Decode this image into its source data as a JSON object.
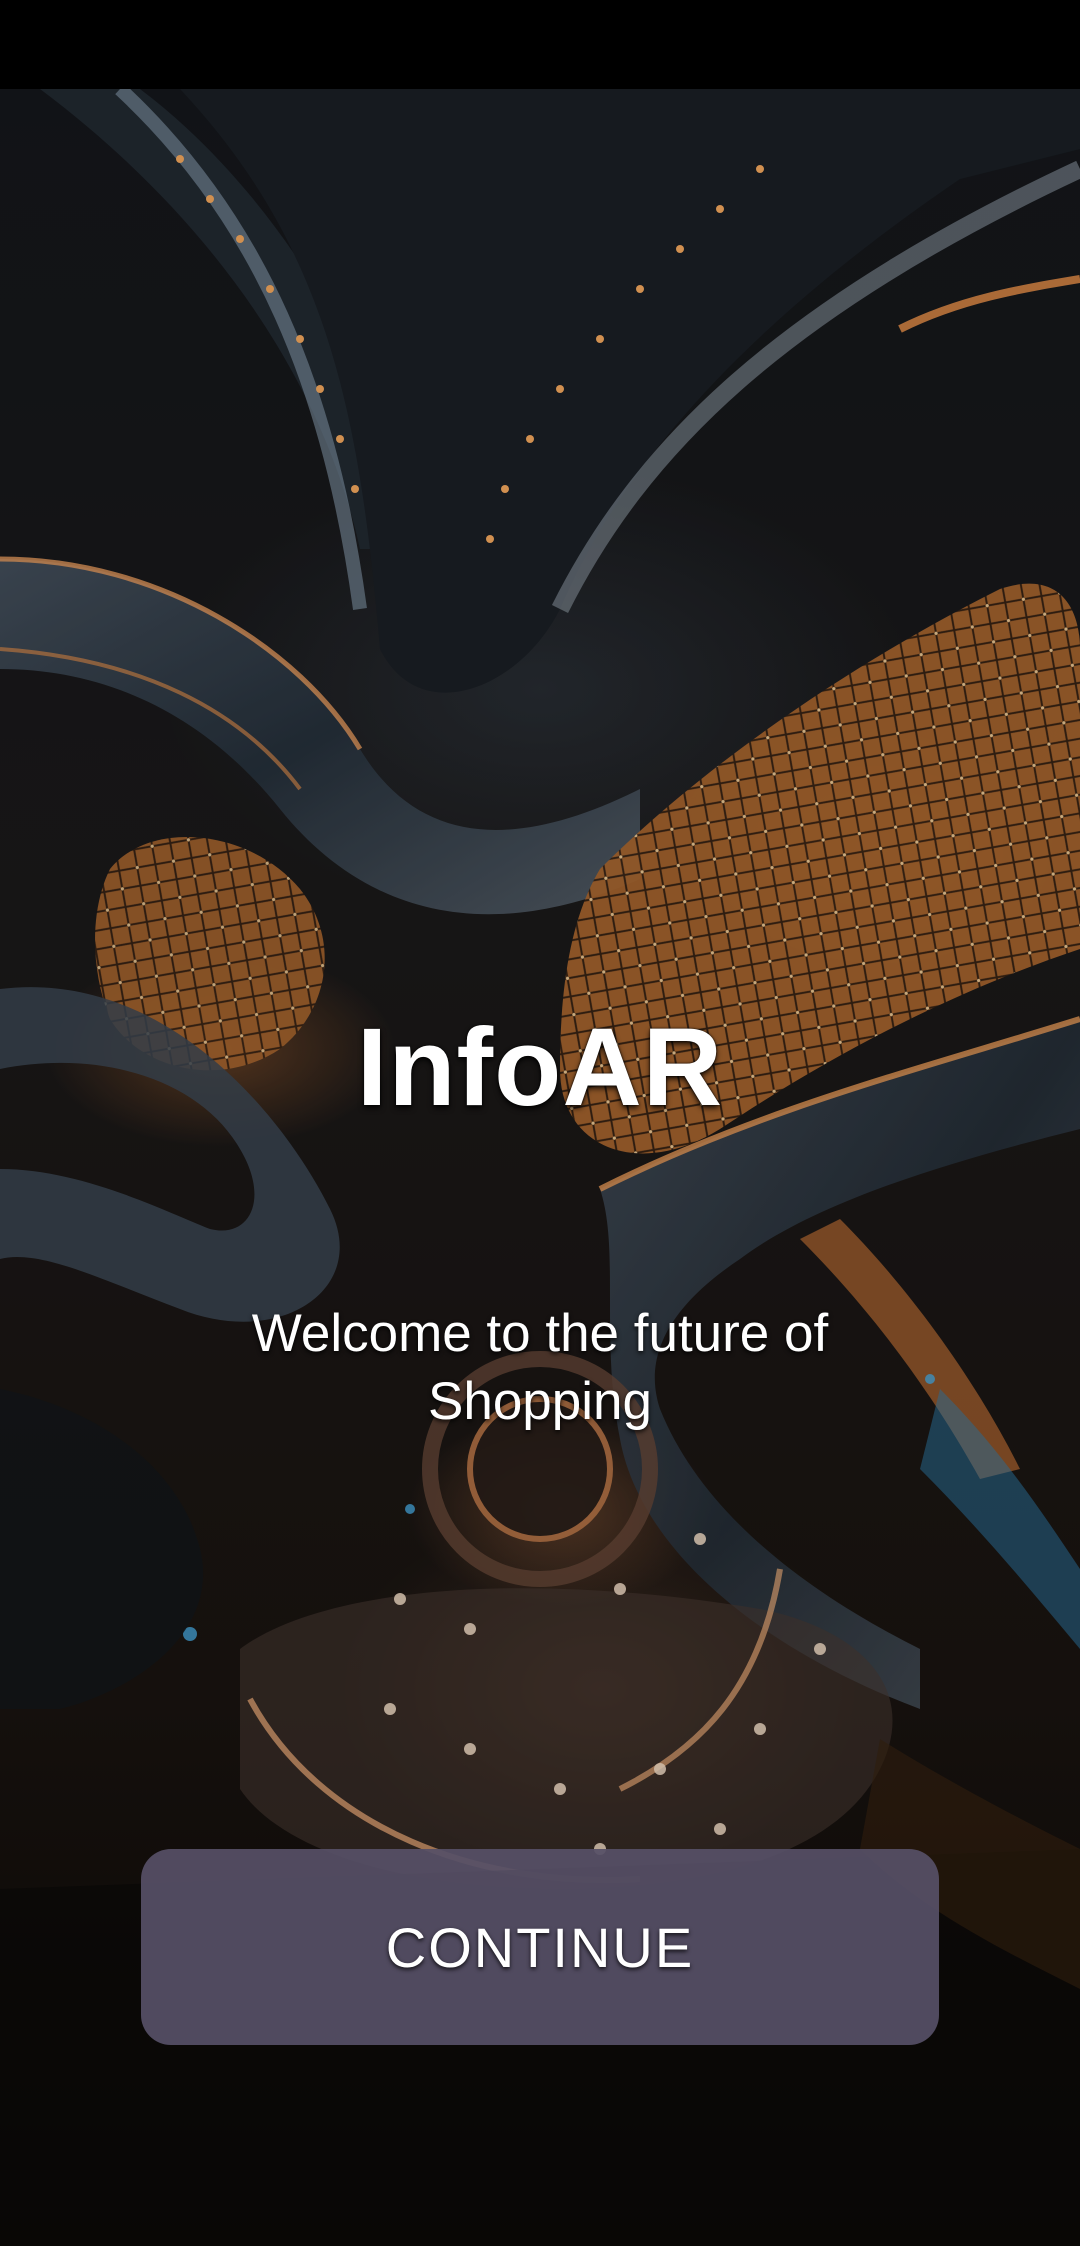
{
  "app": {
    "title": "InfoAR",
    "subtitle": "Welcome to the future of Shopping"
  },
  "actions": {
    "continue_label": "CONTINUE"
  },
  "colors": {
    "status_bar": "#000000",
    "button_bg": "#565066",
    "text": "#ffffff",
    "accent_glow": "#e08a3c"
  }
}
